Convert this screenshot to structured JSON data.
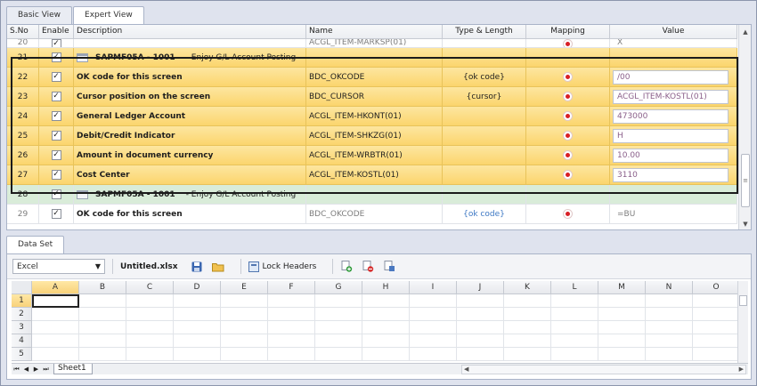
{
  "top_tabs": [
    {
      "label": "Basic View",
      "active": false
    },
    {
      "label": "Expert View",
      "active": true
    }
  ],
  "grid": {
    "columns": [
      "S.No",
      "Enable",
      "Description",
      "Name",
      "Type & Length",
      "Mapping",
      "Value"
    ],
    "rows": [
      {
        "sno": "20",
        "enabled": true,
        "description": "",
        "name": "ACGL_ITEM-MARKSP(01)",
        "type": "",
        "mapping": true,
        "value": "X",
        "style": "clip"
      },
      {
        "sno": "21",
        "enabled": true,
        "description": "SAPMF05A - 1001",
        "subtitle": "-   Enjoy G/L Account Posting",
        "name": "",
        "type": "",
        "mapping": false,
        "value": "",
        "style": "yellow-header"
      },
      {
        "sno": "22",
        "enabled": true,
        "description": "OK code for this screen",
        "name": "BDC_OKCODE",
        "type": "{ok code}",
        "mapping": true,
        "value": "/00",
        "style": "yellow"
      },
      {
        "sno": "23",
        "enabled": true,
        "description": "Cursor position on the screen",
        "name": "BDC_CURSOR",
        "type": "{cursor}",
        "mapping": true,
        "value": "ACGL_ITEM-KOSTL(01)",
        "style": "yellow"
      },
      {
        "sno": "24",
        "enabled": true,
        "description": "General Ledger Account",
        "name": "ACGL_ITEM-HKONT(01)",
        "type": "",
        "mapping": true,
        "value": "473000",
        "style": "yellow"
      },
      {
        "sno": "25",
        "enabled": true,
        "description": "Debit/Credit Indicator",
        "name": "ACGL_ITEM-SHKZG(01)",
        "type": "",
        "mapping": true,
        "value": "H",
        "style": "yellow"
      },
      {
        "sno": "26",
        "enabled": true,
        "description": "Amount in document currency",
        "name": "ACGL_ITEM-WRBTR(01)",
        "type": "",
        "mapping": true,
        "value": "10.00",
        "style": "yellow"
      },
      {
        "sno": "27",
        "enabled": true,
        "description": "Cost Center",
        "name": "ACGL_ITEM-KOSTL(01)",
        "type": "",
        "mapping": true,
        "value": "3110",
        "style": "yellow"
      },
      {
        "sno": "28",
        "enabled": true,
        "description": "SAPMF05A - 1001",
        "subtitle": "-   Enjoy G/L Account Posting",
        "name": "",
        "type": "",
        "mapping": false,
        "value": "",
        "style": "green-header"
      },
      {
        "sno": "29",
        "enabled": true,
        "description": "OK code for this screen",
        "name": "BDC_OKCODE",
        "type": "{ok code}",
        "mapping": true,
        "value": "=BU",
        "style": "plain"
      }
    ]
  },
  "bottom_tab": {
    "label": "Data Set"
  },
  "toolbar": {
    "format_selected": "Excel",
    "file_name": "Untitled.xlsx",
    "lock_headers_label": "Lock Headers",
    "icons": [
      "save-icon",
      "open-folder-icon",
      "lock-headers-icon",
      "add-sheet-icon",
      "remove-sheet-icon",
      "sheet-settings-icon"
    ]
  },
  "spreadsheet": {
    "columns": [
      "A",
      "B",
      "C",
      "D",
      "E",
      "F",
      "G",
      "H",
      "I",
      "J",
      "K",
      "L",
      "M",
      "N",
      "O"
    ],
    "rows": [
      "1",
      "2",
      "3",
      "4",
      "5"
    ],
    "active_cell": "A1",
    "sheet_tabs": [
      "Sheet1"
    ]
  },
  "colors": {
    "selected_row_fill": "#fbd56d",
    "group_row_fill": "#d9ecd9",
    "mapping_pin": "#d81f26",
    "value_text": "#8a5f8a",
    "type_text_blue": "#3d78c4"
  }
}
